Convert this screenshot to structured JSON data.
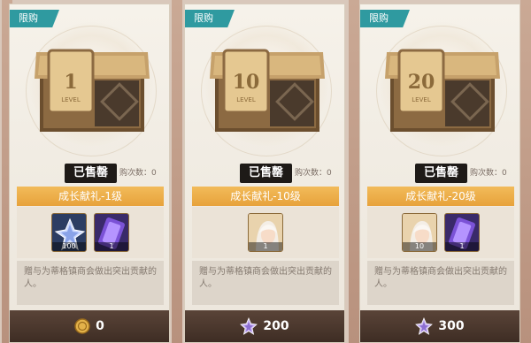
{
  "colors": {
    "tag": "#2f9aa0",
    "title_bar": "#e7a23b",
    "price_bar": "#3e2d24",
    "sold_badge": "#1e1a17"
  },
  "packs": [
    {
      "tag": "限购",
      "chest_number": "1",
      "chest_caption": "LEVEL",
      "status": "已售罄",
      "limit_text": "购次数：0",
      "title": "成长献礼-1级",
      "items": [
        {
          "icon": "crystal-star-icon",
          "qty": "100"
        },
        {
          "icon": "purple-ticket-icon",
          "qty": "1"
        }
      ],
      "description": "赠与为蒂格镇商会做出突出贡献的人。",
      "currency_icon": "gold-coin-icon",
      "price": "0"
    },
    {
      "tag": "限购",
      "chest_number": "10",
      "chest_caption": "LEVEL",
      "status": "已售罄",
      "limit_text": "购次数：0",
      "title": "成长献礼-10级",
      "items": [
        {
          "icon": "character-portrait-icon",
          "qty": "1"
        }
      ],
      "description": "赠与为蒂格镇商会做出突出贡献的人。",
      "currency_icon": "crystal-star-icon",
      "price": "200"
    },
    {
      "tag": "限购",
      "chest_number": "20",
      "chest_caption": "LEVEL",
      "status": "已售罄",
      "limit_text": "购次数：0",
      "title": "成长献礼-20级",
      "items": [
        {
          "icon": "character-portrait-icon",
          "qty": "10"
        },
        {
          "icon": "purple-ticket-icon",
          "qty": "1"
        }
      ],
      "description": "赠与为蒂格镇商会做出突出贡献的人。",
      "currency_icon": "crystal-star-icon",
      "price": "300"
    }
  ]
}
